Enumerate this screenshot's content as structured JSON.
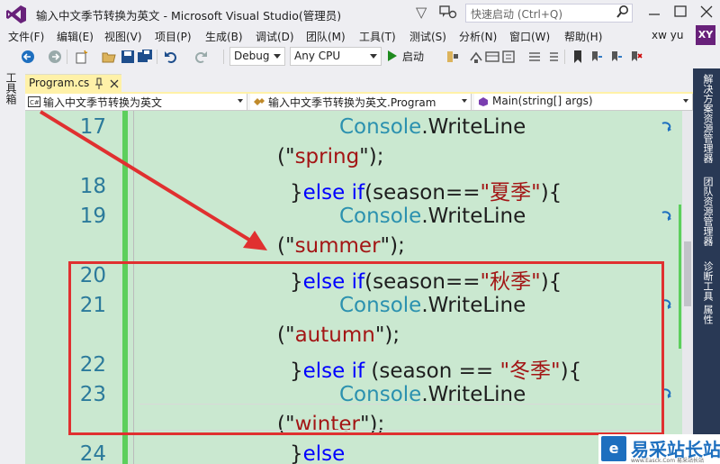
{
  "window": {
    "title": "输入中文季节转换为英文 - Microsoft Visual Studio(管理员)",
    "quick_launch_placeholder": "快速启动 (Ctrl+Q)",
    "user_name": "xw yu",
    "user_initials": "XY"
  },
  "menu": [
    "文件(F)",
    "编辑(E)",
    "视图(V)",
    "项目(P)",
    "生成(B)",
    "调试(D)",
    "团队(M)",
    "工具(T)",
    "测试(S)",
    "分析(N)",
    "窗口(W)",
    "帮助(H)"
  ],
  "toolbar": {
    "configuration": "Debug",
    "platform": "Any CPU",
    "start_label": "启动"
  },
  "left_tabs": [
    "工具箱"
  ],
  "right_tabs": [
    "解决方案资源管理器",
    "团队资源管理器",
    "诊断工具",
    "属性"
  ],
  "document_tab": {
    "label": "Program.cs"
  },
  "navigation": {
    "project": "输入中文季节转换为英文",
    "class": "输入中文季节转换为英文.Program",
    "member": "Main(string[] args)"
  },
  "code_lines": [
    {
      "num": "17",
      "parts": [
        [
          "cls",
          "Console"
        ],
        [
          "",
          ".WriteLine"
        ]
      ]
    },
    {
      "num": "",
      "parts": [
        [
          "",
          "(\""
        ],
        [
          "str",
          "spring"
        ],
        [
          "",
          "\");"
        ]
      ]
    },
    {
      "num": "18",
      "parts": [
        [
          "",
          "}"
        ],
        [
          "kw",
          "else if"
        ],
        [
          "",
          "(season=="
        ],
        [
          "str",
          "\"夏季\""
        ],
        [
          "",
          "){"
        ]
      ]
    },
    {
      "num": "19",
      "parts": [
        [
          "cls",
          "Console"
        ],
        [
          "",
          ".WriteLine"
        ]
      ]
    },
    {
      "num": "",
      "parts": [
        [
          "",
          "(\""
        ],
        [
          "str",
          "summer"
        ],
        [
          "",
          "\");"
        ]
      ]
    },
    {
      "num": "20",
      "parts": [
        [
          "",
          "}"
        ],
        [
          "kw",
          "else if"
        ],
        [
          "",
          "(season=="
        ],
        [
          "str",
          "\"秋季\""
        ],
        [
          "",
          "){"
        ]
      ]
    },
    {
      "num": "21",
      "parts": [
        [
          "cls",
          "Console"
        ],
        [
          "",
          ".WriteLine"
        ]
      ]
    },
    {
      "num": "",
      "parts": [
        [
          "",
          "(\""
        ],
        [
          "str",
          "autumn"
        ],
        [
          "",
          "\");"
        ]
      ]
    },
    {
      "num": "22",
      "parts": [
        [
          "",
          "}"
        ],
        [
          "kw",
          "else if"
        ],
        [
          "",
          " (season == "
        ],
        [
          "str",
          "\"冬季\""
        ],
        [
          "",
          "){"
        ]
      ]
    },
    {
      "num": "23",
      "parts": [
        [
          "cls",
          "Console"
        ],
        [
          "",
          ".WriteLine"
        ]
      ]
    },
    {
      "num": "",
      "parts": [
        [
          "",
          "(\""
        ],
        [
          "str",
          "winter"
        ],
        [
          "",
          "\");"
        ]
      ]
    },
    {
      "num": "24",
      "parts": [
        [
          "",
          "}"
        ],
        [
          "kw",
          "else"
        ]
      ]
    }
  ],
  "watermark": {
    "logo": "e",
    "text": "易采站长站",
    "sub": "www.Easck.Com 易采站长站"
  },
  "colors": {
    "editor_bg": "#cae8d0",
    "line_number": "#2b7a9b",
    "keyword": "#0000ff",
    "class": "#2b91af",
    "string": "#a31515",
    "annotation": "#e03030",
    "tab_active": "#fff1a8"
  }
}
